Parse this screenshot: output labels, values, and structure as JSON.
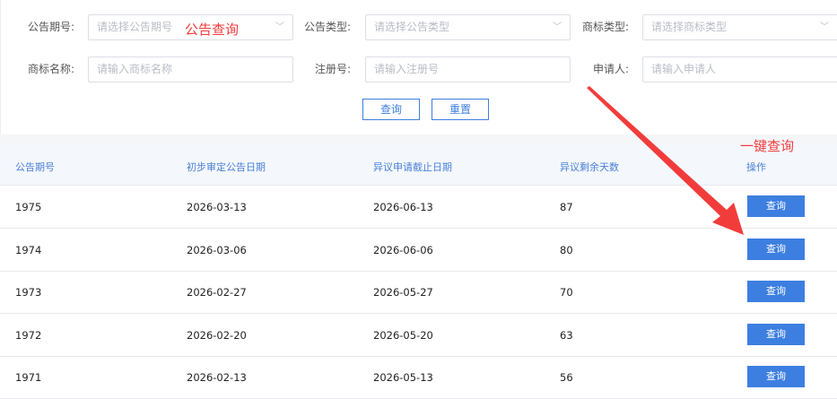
{
  "filters": {
    "issue": {
      "label": "公告期号:",
      "placeholder": "请选择公告期号"
    },
    "type": {
      "label": "公告类型:",
      "placeholder": "请选择公告类型"
    },
    "tm_type": {
      "label": "商标类型:",
      "placeholder": "请选择商标类型"
    },
    "name": {
      "label": "商标名称:",
      "placeholder": "请输入商标名称"
    },
    "reg": {
      "label": "注册号:",
      "placeholder": "请输入注册号"
    },
    "applicant": {
      "label": "申请人:",
      "placeholder": "请输入申请人"
    },
    "search_label": "查询",
    "reset_label": "重置"
  },
  "annotations": {
    "top": "公告查询",
    "right": "一键查询",
    "color": "#f23c3c"
  },
  "table": {
    "headers": [
      "公告期号",
      "初步审定公告日期",
      "异议申请截止日期",
      "异议剩余天数",
      "操作"
    ],
    "rows": [
      {
        "issue": "1975",
        "prelim": "2026-03-13",
        "deadline": "2026-06-13",
        "days": "87",
        "action": "查询"
      },
      {
        "issue": "1974",
        "prelim": "2026-03-06",
        "deadline": "2026-06-06",
        "days": "80",
        "action": "查询"
      },
      {
        "issue": "1973",
        "prelim": "2026-02-27",
        "deadline": "2026-05-27",
        "days": "70",
        "action": "查询"
      },
      {
        "issue": "1972",
        "prelim": "2026-02-20",
        "deadline": "2026-05-20",
        "days": "63",
        "action": "查询"
      },
      {
        "issue": "1971",
        "prelim": "2026-02-13",
        "deadline": "2026-05-13",
        "days": "56",
        "action": "查询"
      }
    ]
  },
  "accent": "#3d7fe0"
}
